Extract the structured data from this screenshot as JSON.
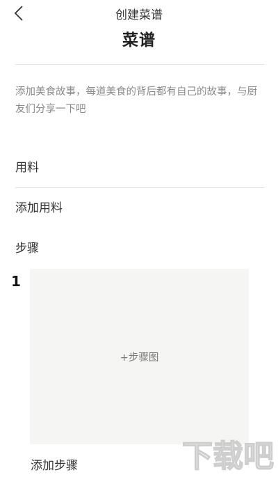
{
  "header": {
    "title": "创建菜谱",
    "back_icon": "chevron-left-icon"
  },
  "recipe": {
    "name": "菜谱",
    "story_placeholder": "添加美食故事，每道美食的背后都有自己的故事，与厨友们分享一下吧"
  },
  "ingredients": {
    "label": "用料",
    "add_label": "添加用料"
  },
  "steps": {
    "label": "步骤",
    "items": [
      {
        "number": "1",
        "photo_label": "+步骤图"
      }
    ],
    "add_label": "添加步骤"
  },
  "watermark": {
    "text": "下载吧"
  }
}
